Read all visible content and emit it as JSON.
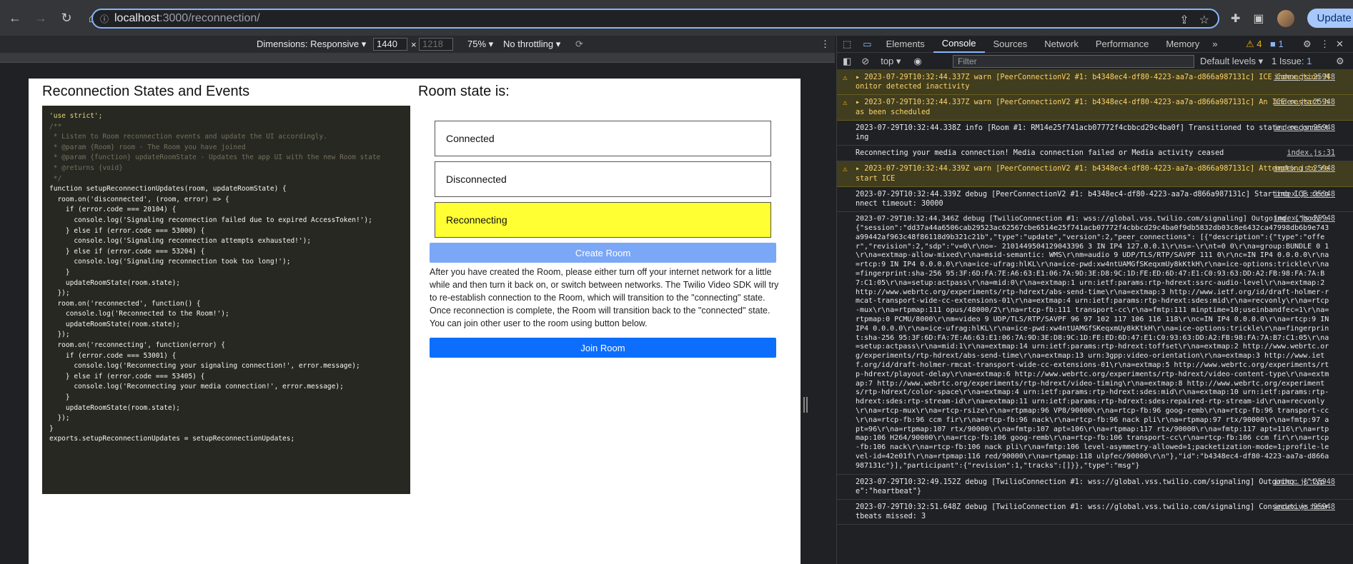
{
  "browser": {
    "url_host": "localhost",
    "url_path": ":3000/reconnection/",
    "update_label": "Update"
  },
  "device_toolbar": {
    "dimensions_label": "Dimensions: Responsive",
    "width_value": "1440",
    "height_placeholder": "1218",
    "times": "×",
    "zoom": "75%",
    "throttling": "No throttling"
  },
  "page": {
    "left_title": "Reconnection States and Events",
    "right_title": "Room state is:",
    "states": [
      "Connected",
      "Disconnected",
      "Reconnecting"
    ],
    "active_state_index": 2,
    "create_button": "Create Room",
    "description": "After you have created the Room, please either turn off your internet network for a little while and then turn it back on, or switch between networks. The Twilio Video SDK will try to re-establish connection to the Room, which will transition to the \"connecting\" state. Once reconnection is complete, the Room will transition back to the \"connected\" state. You can join other user to the room using button below.",
    "join_button": "Join Room",
    "code_lines": [
      "'use strict';",
      "",
      "/**",
      " * Listen to Room reconnection events and update the UI accordingly.",
      " * @param {Room} room - The Room you have joined",
      " * @param {function} updateRoomState - Updates the app UI with the new Room state",
      " * @returns {void}",
      " */",
      "function setupReconnectionUpdates(room, updateRoomState) {",
      "  room.on('disconnected', (room, error) => {",
      "    if (error.code === 20104) {",
      "      console.log('Signaling reconnection failed due to expired AccessToken!');",
      "    } else if (error.code === 53000) {",
      "      console.log('Signaling reconnection attempts exhausted!');",
      "    } else if (error.code === 53204) {",
      "      console.log('Signaling reconnection took too long!');",
      "    }",
      "    updateRoomState(room.state);",
      "  });",
      "",
      "  room.on('reconnected', function() {",
      "    console.log('Reconnected to the Room!');",
      "    updateRoomState(room.state);",
      "  });",
      "",
      "  room.on('reconnecting', function(error) {",
      "    if (error.code === 53001) {",
      "      console.log('Reconnecting your signaling connection!', error.message);",
      "    } else if (error.code === 53405) {",
      "      console.log('Reconnecting your media connection!', error.message);",
      "    }",
      "    updateRoomState(room.state);",
      "  });",
      "}",
      "",
      "exports.setupReconnectionUpdates = setupReconnectionUpdates;"
    ]
  },
  "devtools": {
    "tabs": [
      "Elements",
      "Console",
      "Sources",
      "Network",
      "Performance",
      "Memory"
    ],
    "active_tab": "Console",
    "warn_count": "4",
    "info_count": "1",
    "context": "top",
    "filter_placeholder": "Filter",
    "levels": "Default levels",
    "issues": "1 Issue:",
    "issues_count": "1",
    "logs": [
      {
        "level": "warn",
        "text": "2023-07-29T10:32:44.337Z warn [PeerConnectionV2 #1: b4348ec4-df80-4223-aa7a-d866a987131c] ICE Connection Monitor detected inactivity",
        "src": "index.js:25948"
      },
      {
        "level": "warn",
        "text": "2023-07-29T10:32:44.337Z warn [PeerConnectionV2 #1: b4348ec4-df80-4223-aa7a-d866a987131c] An ICE restart has been scheduled",
        "src": "index.js:25948"
      },
      {
        "level": "info",
        "text": "2023-07-29T10:32:44.338Z info [Room #1: RM14e25f741acb07772f4cbbcd29c4ba0f] Transitioned to state: reconnecting",
        "src": "index.js:25948"
      },
      {
        "level": "info",
        "text": "Reconnecting your media connection! Media connection failed or Media activity ceased",
        "src": "index.js:31"
      },
      {
        "level": "warn",
        "text": "2023-07-29T10:32:44.339Z warn [PeerConnectionV2 #1: b4348ec4-df80-4223-aa7a-d866a987131c] Attempting to restart ICE",
        "src": "index.js:25948"
      },
      {
        "level": "info",
        "text": "2023-07-29T10:32:44.339Z debug [PeerConnectionV2 #1: b4348ec4-df80-4223-aa7a-d866a987131c] Starting ICE reconnect timeout: 30000",
        "src": "index.js:25948"
      },
      {
        "level": "body",
        "text": "2023-07-29T10:32:44.346Z debug [TwilioConnection #1: wss://global.vss.twilio.com/signaling] Outgoing: {\"body\": {\"session\":\"dd37a44a6506cab29523ac62567cbe6514e25f741acb07772f4cbbcd29c4ba0f9db5832db03c8e6432ca47998db6b9e743a99442af963c48f86118d9b321c21b\",\"type\":\"update\",\"version\":2,\"peer_connections\": [{\"description\":{\"type\":\"offer\",\"revision\":2,\"sdp\":\"v=0\\r\\no=- 2101449504129043396 3 IN IP4 127.0.0.1\\r\\ns=-\\r\\nt=0 0\\r\\na=group:BUNDLE 0 1\\r\\na=extmap-allow-mixed\\r\\na=msid-semantic: WMS\\r\\nm=audio 9 UDP/TLS/RTP/SAVPF 111 0\\r\\nc=IN IP4 0.0.0.0\\r\\na=rtcp:9 IN IP4 0.0.0.0\\r\\na=ice-ufrag:hlKL\\r\\na=ice-pwd:xw4ntUAMGfSKeqxmUy8kKtkH\\r\\na=ice-options:trickle\\r\\na=fingerprint:sha-256 95:3F:6D:FA:7E:A6:63:E1:06:7A:9D:3E:D8:9C:1D:FE:ED:6D:47:E1:C0:93:63:DD:A2:FB:98:FA:7A:B7:C1:05\\r\\na=setup:actpass\\r\\na=mid:0\\r\\na=extmap:1 urn:ietf:params:rtp-hdrext:ssrc-audio-level\\r\\na=extmap:2 http://www.webrtc.org/experiments/rtp-hdrext/abs-send-time\\r\\na=extmap:3 http://www.ietf.org/id/draft-holmer-rmcat-transport-wide-cc-extensions-01\\r\\na=extmap:4 urn:ietf:params:rtp-hdrext:sdes:mid\\r\\na=recvonly\\r\\na=rtcp-mux\\r\\na=rtpmap:111 opus/48000/2\\r\\na=rtcp-fb:111 transport-cc\\r\\na=fmtp:111 minptime=10;useinbandfec=1\\r\\na=rtpmap:0 PCMU/8000\\r\\nm=video 9 UDP/TLS/RTP/SAVPF 96 97 102 117 106 116 118\\r\\nc=IN IP4 0.0.0.0\\r\\na=rtcp:9 IN IP4 0.0.0.0\\r\\na=ice-ufrag:hlKL\\r\\na=ice-pwd:xw4ntUAMGfSKeqxmUy8kKtkH\\r\\na=ice-options:trickle\\r\\na=fingerprint:sha-256 95:3F:6D:FA:7E:A6:63:E1:06:7A:9D:3E:D8:9C:1D:FE:ED:6D:47:E1:C0:93:63:DD:A2:FB:98:FA:7A:B7:C1:05\\r\\na=setup:actpass\\r\\na=mid:1\\r\\na=extmap:14 urn:ietf:params:rtp-hdrext:toffset\\r\\na=extmap:2 http://www.webrtc.org/experiments/rtp-hdrext/abs-send-time\\r\\na=extmap:13 urn:3gpp:video-orientation\\r\\na=extmap:3 http://www.ietf.org/id/draft-holmer-rmcat-transport-wide-cc-extensions-01\\r\\na=extmap:5 http://www.webrtc.org/experiments/rtp-hdrext/playout-delay\\r\\na=extmap:6 http://www.webrtc.org/experiments/rtp-hdrext/video-content-type\\r\\na=extmap:7 http://www.webrtc.org/experiments/rtp-hdrext/video-timing\\r\\na=extmap:8 http://www.webrtc.org/experiments/rtp-hdrext/color-space\\r\\na=extmap:4 urn:ietf:params:rtp-hdrext:sdes:mid\\r\\na=extmap:10 urn:ietf:params:rtp-hdrext:sdes:rtp-stream-id\\r\\na=extmap:11 urn:ietf:params:rtp-hdrext:sdes:repaired-rtp-stream-id\\r\\na=recvonly\\r\\na=rtcp-mux\\r\\na=rtcp-rsize\\r\\na=rtpmap:96 VP8/90000\\r\\na=rtcp-fb:96 goog-remb\\r\\na=rtcp-fb:96 transport-cc\\r\\na=rtcp-fb:96 ccm fir\\r\\na=rtcp-fb:96 nack\\r\\na=rtcp-fb:96 nack pli\\r\\na=rtpmap:97 rtx/90000\\r\\na=fmtp:97 apt=96\\r\\na=rtpmap:107 rtx/90000\\r\\na=fmtp:107 apt=106\\r\\na=rtpmap:117 rtx/90000\\r\\na=fmtp:117 apt=116\\r\\na=rtpmap:106 H264/90000\\r\\na=rtcp-fb:106 goog-remb\\r\\na=rtcp-fb:106 transport-cc\\r\\na=rtcp-fb:106 ccm fir\\r\\na=rtcp-fb:106 nack\\r\\na=rtcp-fb:106 nack pli\\r\\na=fmtp:106 level-asymmetry-allowed=1;packetization-mode=1;profile-level-id=42e01f\\r\\na=rtpmap:116 red/90000\\r\\na=rtpmap:118 ulpfec/90000\\r\\n\"},\"id\":\"b4348ec4-df80-4223-aa7a-d866a987131c\"}],\"participant\":{\"revision\":1,\"tracks\":[]}},\"type\":\"msg\"}",
        "src": "index.js:25948"
      },
      {
        "level": "info",
        "text": "2023-07-29T10:32:49.152Z debug [TwilioConnection #1: wss://global.vss.twilio.com/signaling] Outgoing: {\"type\":\"heartbeat\"}",
        "src": "index.js:25948"
      },
      {
        "level": "info",
        "text": "2023-07-29T10:32:51.648Z debug [TwilioConnection #1: wss://global.vss.twilio.com/signaling] Consecutive heartbeats missed: 3",
        "src": "index.js:25948"
      }
    ]
  }
}
